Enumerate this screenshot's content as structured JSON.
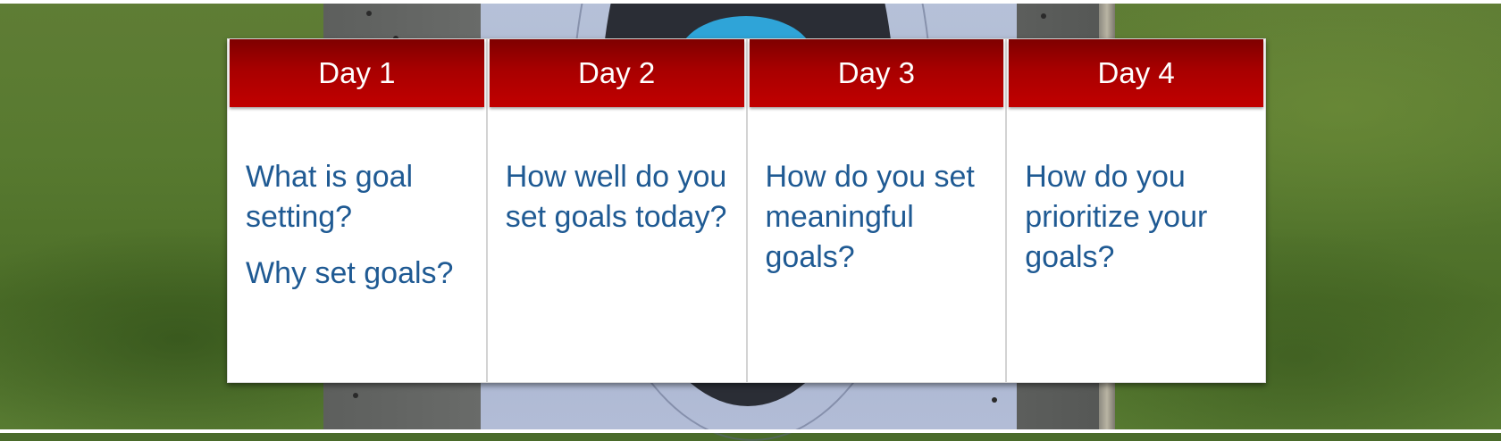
{
  "schedule": {
    "days": [
      {
        "heading": "Day 1",
        "questions": [
          "What is goal setting?",
          "Why set goals?"
        ]
      },
      {
        "heading": "Day 2",
        "questions": [
          "How well do you set goals today?"
        ]
      },
      {
        "heading": "Day 3",
        "questions": [
          "How do you set meaningful goals?"
        ]
      },
      {
        "heading": "Day 4",
        "questions": [
          "How do you prioritize your goals?"
        ]
      }
    ]
  },
  "colors": {
    "header_red": "#c10000",
    "question_blue": "#1f5a93"
  }
}
